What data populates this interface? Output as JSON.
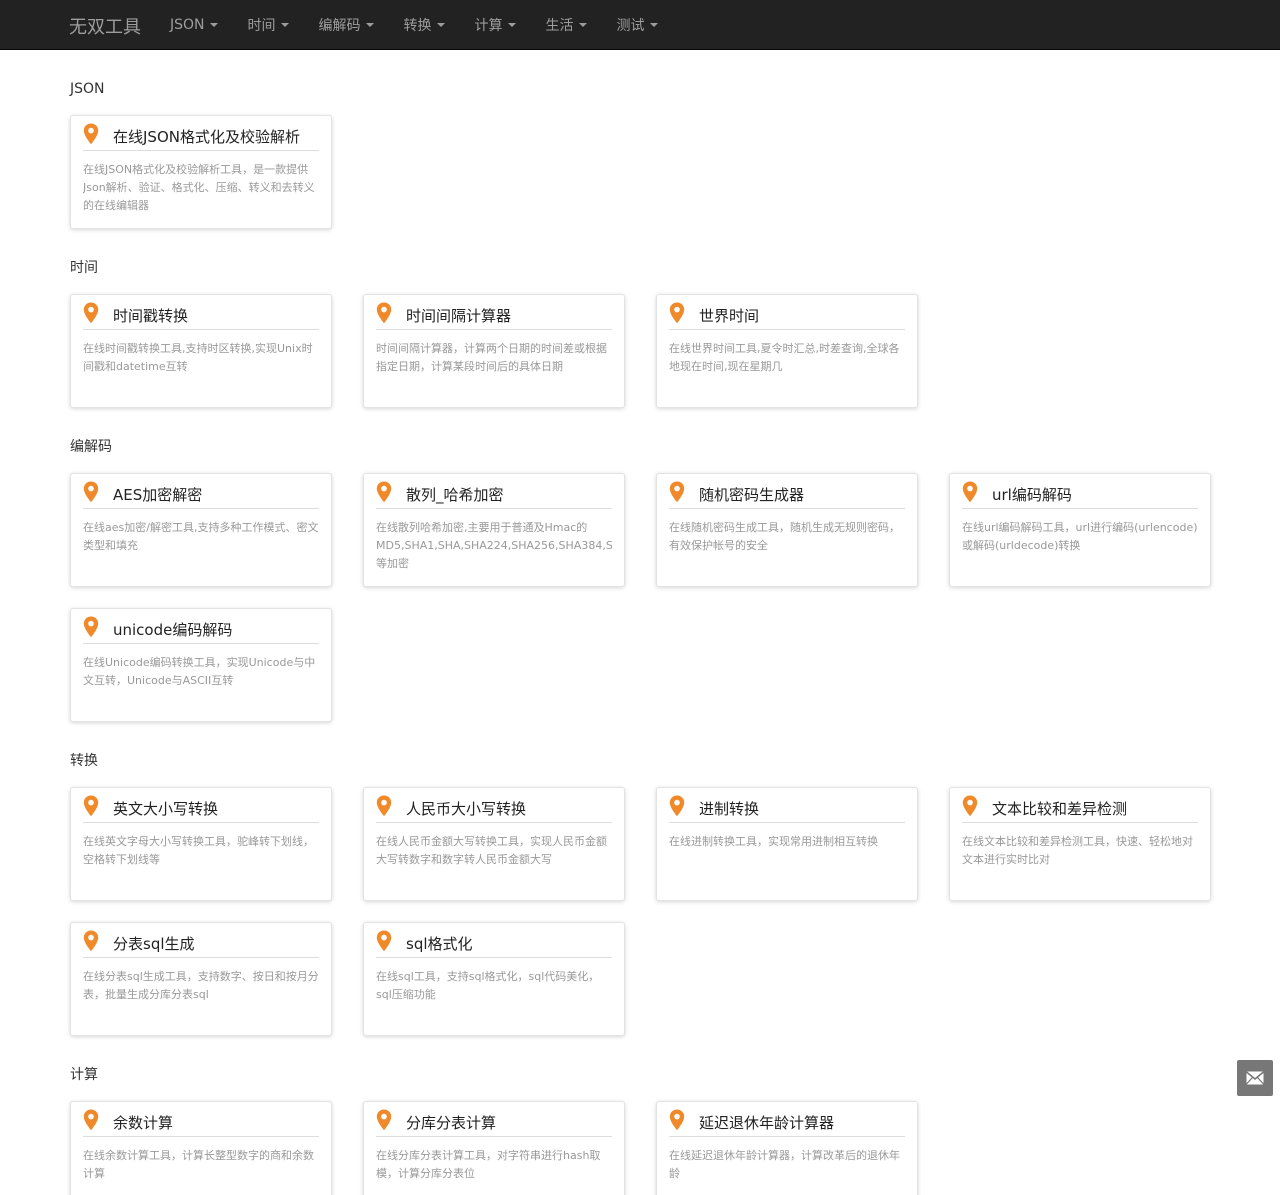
{
  "brand": "无双工具",
  "nav": [
    {
      "label": "JSON"
    },
    {
      "label": "时间"
    },
    {
      "label": "编解码"
    },
    {
      "label": "转换"
    },
    {
      "label": "计算"
    },
    {
      "label": "生活"
    },
    {
      "label": "测试"
    }
  ],
  "colors": {
    "navbar_bg": "#222222",
    "nav_text": "#9d9d9d",
    "pin": "#f0892a",
    "desc_text": "#999999"
  },
  "icons": {
    "card": "map-pin-icon",
    "float_button": "envelope-icon",
    "dropdown": "caret-down-icon"
  },
  "sections": [
    {
      "title": "JSON",
      "cards": [
        {
          "title": "在线JSON格式化及校验解析",
          "desc": "在线JSON格式化及校验解析工具，是一款提供Json解析、验证、格式化、压缩、转义和去转义的在线编辑器"
        }
      ]
    },
    {
      "title": "时间",
      "cards": [
        {
          "title": "时间戳转换",
          "desc": "在线时间戳转换工具,支持时区转换,实现Unix时间戳和datetime互转"
        },
        {
          "title": "时间间隔计算器",
          "desc": "时间间隔计算器，计算两个日期的时间差或根据指定日期，计算某段时间后的具体日期"
        },
        {
          "title": "世界时间",
          "desc": "在线世界时间工具,夏令时汇总,时差查询,全球各地现在时间,现在星期几"
        }
      ]
    },
    {
      "title": "编解码",
      "cards": [
        {
          "title": "AES加密解密",
          "desc": "在线aes加密/解密工具,支持多种工作模式、密文类型和填充"
        },
        {
          "title": "散列_哈希加密",
          "desc": "在线散列哈希加密,主要用于普通及Hmac的MD5,SHA1,SHA,SHA224,SHA256,SHA384,SHA512等加密"
        },
        {
          "title": "随机密码生成器",
          "desc": "在线随机密码生成工具，随机生成无规则密码，有效保护帐号的安全"
        },
        {
          "title": "url编码解码",
          "desc": "在线url编码解码工具，url进行编码(urlencode)或解码(urldecode)转换"
        },
        {
          "title": "unicode编码解码",
          "desc": "在线Unicode编码转换工具，实现Unicode与中文互转，Unicode与ASCII互转"
        }
      ]
    },
    {
      "title": "转换",
      "cards": [
        {
          "title": "英文大小写转换",
          "desc": "在线英文字母大小写转换工具，驼峰转下划线，空格转下划线等"
        },
        {
          "title": "人民币大小写转换",
          "desc": "在线人民币金额大写转换工具，实现人民币金额大写转数字和数字转人民币金额大写"
        },
        {
          "title": "进制转换",
          "desc": "在线进制转换工具，实现常用进制相互转换"
        },
        {
          "title": "文本比较和差异检测",
          "desc": "在线文本比较和差异检测工具，快速、轻松地对文本进行实时比对"
        },
        {
          "title": "分表sql生成",
          "desc": "在线分表sql生成工具，支持数字、按日和按月分表，批量生成分库分表sql"
        },
        {
          "title": "sql格式化",
          "desc": "在线sql工具，支持sql格式化，sql代码美化，sql压缩功能"
        }
      ]
    },
    {
      "title": "计算",
      "cards": [
        {
          "title": "余数计算",
          "desc": "在线余数计算工具，计算长整型数字的商和余数计算"
        },
        {
          "title": "分库分表计算",
          "desc": "在线分库分表计算工具，对字符串进行hash取模，计算分库分表位"
        },
        {
          "title": "延迟退休年龄计算器",
          "desc": "在线延迟退休年龄计算器，计算改革后的退休年龄"
        }
      ]
    }
  ]
}
